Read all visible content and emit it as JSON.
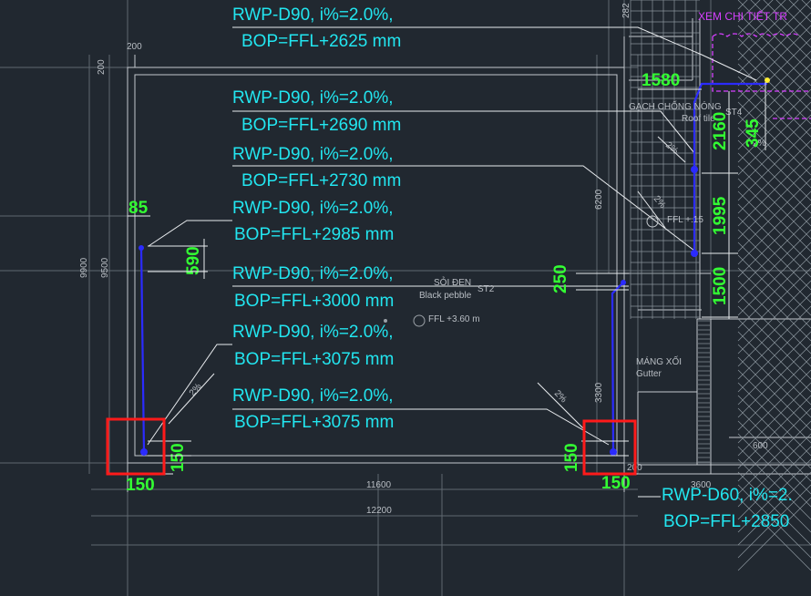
{
  "drawing": {
    "colors": {
      "background": "#212830",
      "annotation": "#22e6f0",
      "dimension": "#33ff33",
      "pipe": "#2b2bff",
      "highlight": "#ff1a1a",
      "revision": "#d640ff"
    },
    "callouts": [
      {
        "line1": "RWP-D90, i%=2.0%,",
        "line2": "BOP=FFL+2625 mm"
      },
      {
        "line1": "RWP-D90, i%=2.0%,",
        "line2": "BOP=FFL+2690 mm"
      },
      {
        "line1": "RWP-D90, i%=2.0%,",
        "line2": "BOP=FFL+2730 mm"
      },
      {
        "line1": "RWP-D90, i%=2.0%,",
        "line2": "BOP=FFL+2985 mm"
      },
      {
        "line1": "RWP-D90, i%=2.0%,",
        "line2": "BOP=FFL+3000 mm"
      },
      {
        "line1": "RWP-D90, i%=2.0%,",
        "line2": "BOP=FFL+3075 mm"
      },
      {
        "line1": "RWP-D90, i%=2.0%,",
        "line2": "BOP=FFL+3075 mm"
      },
      {
        "line1": "RWP-D60, i%=2.",
        "line2": "BOP=FFL+2850"
      }
    ],
    "dims_green": {
      "d85": "85",
      "d590": "590",
      "d150_left_h": "150",
      "d150_left_v": "150",
      "d250": "250",
      "d150_right_v": "150",
      "d150_right_h": "150",
      "d1580": "1580",
      "d2160": "2160",
      "d345": "345",
      "d1995": "1995",
      "d1500": "1500"
    },
    "small_text": {
      "gach": "GẠCH CHỐNG NÓNG",
      "roof": "Roof tile",
      "st4": "ST4",
      "soi": "SỎI ĐEN",
      "pebble": "Black pebble",
      "st2": "ST2",
      "ffl360": "FFL +3.60 m",
      "ffl_right": "FFL +.15",
      "mang": "MÁNG XỐI",
      "gutter": "Gutter",
      "xem": "XEM CHI TIẾT TR",
      "pct1": "2%",
      "pct2": "2%",
      "pct3": "2%",
      "pct4": "2%",
      "pct5": "2%",
      "d200top": "200",
      "d200left": "200",
      "d9900": "9900",
      "d9500": "9500",
      "d6200": "6200",
      "d3300": "3300",
      "d11600": "11600",
      "d12200": "12200",
      "d3600": "3600",
      "d600": "600",
      "d200r": "200",
      "d282": "282"
    }
  }
}
